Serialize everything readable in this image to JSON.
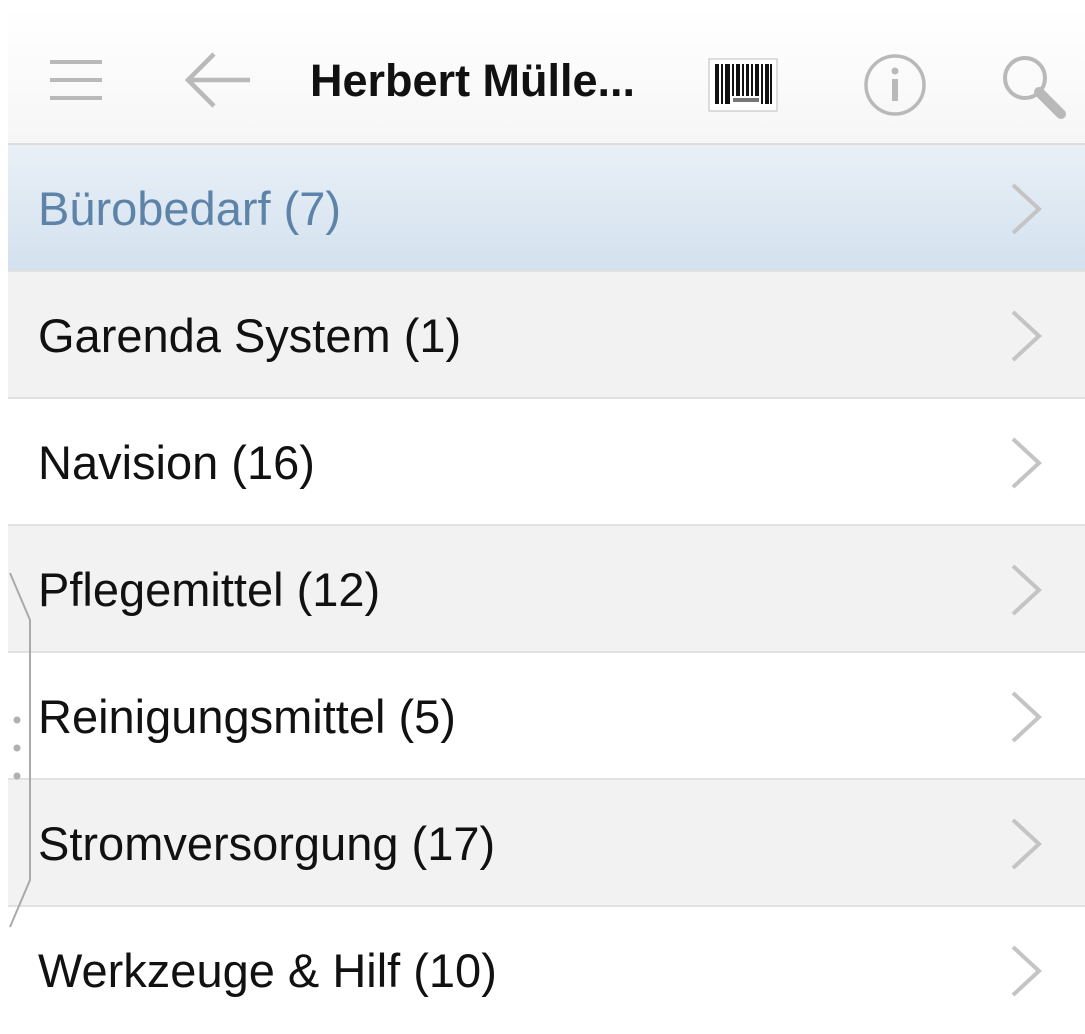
{
  "toolbar": {
    "title": "Herbert Mülle...",
    "icons": [
      "menu-icon",
      "back-arrow-icon",
      "barcode-icon",
      "info-icon",
      "search-icon"
    ]
  },
  "list": {
    "items": [
      {
        "label": "Bürobedarf (7)",
        "selected": true
      },
      {
        "label": "Garenda System (1)"
      },
      {
        "label": "Navision (16)"
      },
      {
        "label": "Pflegemittel (12)"
      },
      {
        "label": "Reinigungsmittel (5)"
      },
      {
        "label": "Stromversorgung (17)"
      },
      {
        "label": "Werkzeuge & Hilf (10)"
      }
    ]
  },
  "colors": {
    "selected_text": "#5e83a8",
    "selected_bg": "#dbe6f1",
    "icon_gray": "#b9b9b9",
    "row_alt_bg": "#f2f2f2"
  }
}
